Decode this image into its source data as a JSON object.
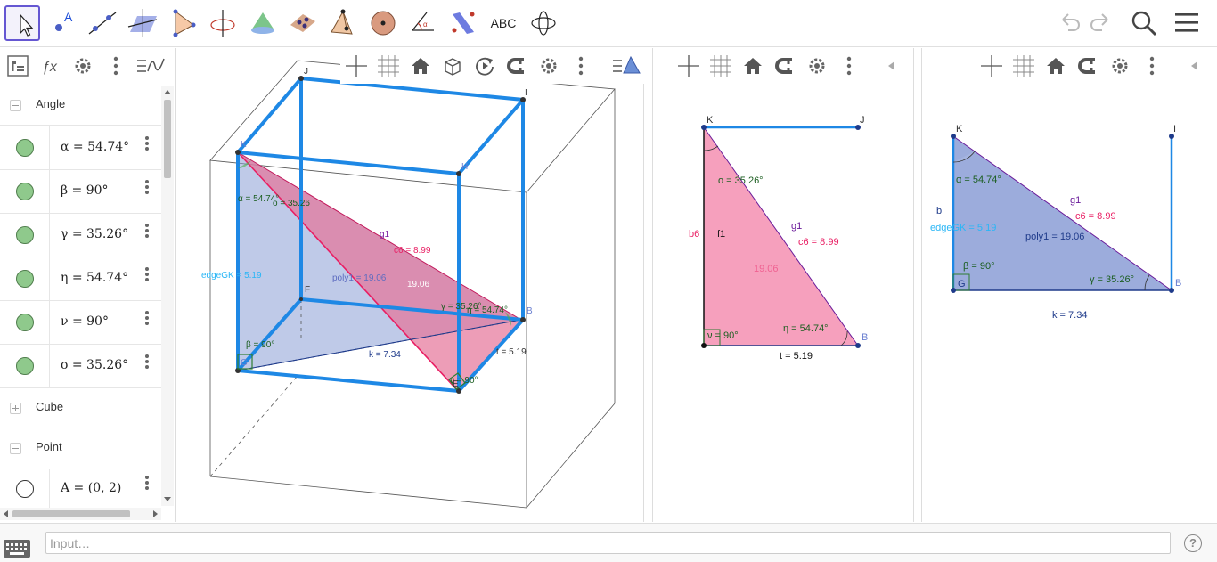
{
  "toolbar": {
    "tools": [
      {
        "name": "move-tool",
        "active": true
      },
      {
        "name": "point-tool"
      },
      {
        "name": "line-tool"
      },
      {
        "name": "plane-tool"
      },
      {
        "name": "polygon-tool"
      },
      {
        "name": "circle-axis-tool"
      },
      {
        "name": "cone-tool"
      },
      {
        "name": "plane-point-tool"
      },
      {
        "name": "pyramid-tool"
      },
      {
        "name": "sphere-tool"
      },
      {
        "name": "angle-tool"
      },
      {
        "name": "reflect-plane-tool"
      },
      {
        "name": "text-tool",
        "label": "ABC"
      },
      {
        "name": "rotate-view-tool"
      }
    ],
    "point_tool_label": "A",
    "text_tool_label": "ABC"
  },
  "algebra": {
    "sections": [
      {
        "label": "Angle",
        "expanded": true
      },
      {
        "label": "Cube",
        "expanded": false
      },
      {
        "label": "Point",
        "expanded": true
      }
    ],
    "angle_items": [
      {
        "value": "α = 54.74°"
      },
      {
        "value": "β = 90°"
      },
      {
        "value": "γ = 35.26°"
      },
      {
        "value": "η = 54.74°"
      },
      {
        "value": "ν = 90°"
      },
      {
        "value": "ο = 35.26°"
      }
    ],
    "point_items": [
      {
        "value": "A = (0, 2)"
      }
    ]
  },
  "view3d": {
    "labels": {
      "J": "J",
      "I": "I",
      "K": "K",
      "H": "H",
      "F": "F",
      "B": "B",
      "G": "G",
      "E": "E",
      "alpha": "α = 54.74°",
      "omicron": "ο = 35.26",
      "g1": "g1",
      "c6": "c6 = 8.99",
      "edgeGK": "edgeGK = 5.19",
      "poly1": "poly1 = 19.06",
      "poly_val": "19.06",
      "gamma": "γ = 35.26°",
      "eta": "η = 54.74°",
      "beta": "β = 90°",
      "k": "k = 7.34",
      "t": "t = 5.19",
      "nu": "ν = 90°"
    }
  },
  "view2a": {
    "labels": {
      "K": "K",
      "J": "J",
      "B": "B",
      "omicron": "ο = 35.26°",
      "g1": "g1",
      "c6": "c6 = 8.99",
      "b6": "b6",
      "f1": "f1",
      "area": "19.06",
      "eta": "η = 54.74°",
      "nu": "ν = 90°",
      "t": "t = 5.19"
    }
  },
  "view2b": {
    "labels": {
      "K": "K",
      "I": "I",
      "B": "B",
      "G": "G",
      "alpha": "α = 54.74°",
      "g1": "g1",
      "c6": "c6 = 8.99",
      "b": "b",
      "edgeGK": "edgeGK = 5.19",
      "poly1": "poly1 = 19.06",
      "beta": "β = 90°",
      "gamma": "γ = 35.26°",
      "k": "k = 7.34"
    }
  },
  "input": {
    "placeholder": "Input…"
  },
  "colors": {
    "accent": "#6557d2",
    "edge_blue": "#1e88e5",
    "pink": "#f48fb1",
    "poly_blue": "#8b9ed6",
    "angle_green": "#1b5e20"
  }
}
